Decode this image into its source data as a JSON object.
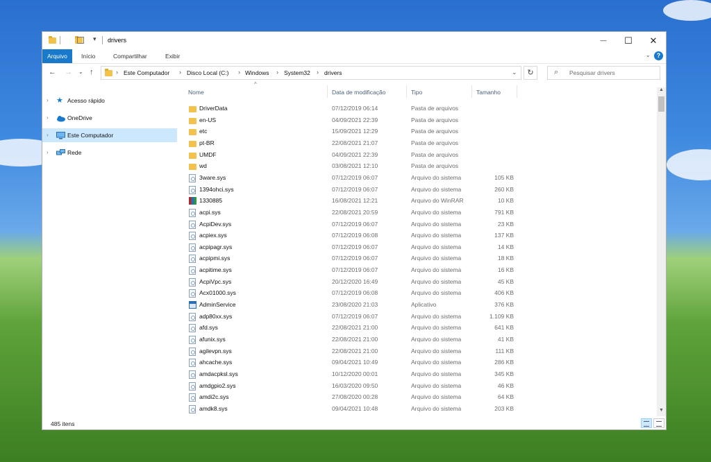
{
  "window": {
    "title": "drivers",
    "controls": {
      "minimize": "—",
      "maximize": "☐",
      "close": "✕"
    }
  },
  "ribbon": {
    "tabs": [
      {
        "label": "Arquivo"
      },
      {
        "label": "Início"
      },
      {
        "label": "Compartilhar"
      },
      {
        "label": "Exibir"
      }
    ],
    "help_label": "?",
    "expand_glyph": "⌄"
  },
  "nav": {
    "back": "←",
    "forward": "→",
    "recent": "⌄",
    "up": "↑",
    "breadcrumbs": [
      "Este Computador",
      "Disco Local (C:)",
      "Windows",
      "System32",
      "drivers"
    ],
    "breadcrumb_separator": "›",
    "dropdown": "⌄",
    "refresh": "↻",
    "search_placeholder": "Pesquisar drivers",
    "search_icon": "⌕"
  },
  "sidebar": {
    "items": [
      {
        "label": "Acesso rápido",
        "icon": "star-icon",
        "color": "#1979ca"
      },
      {
        "label": "OneDrive",
        "icon": "cloud-icon",
        "color": "#1979ca"
      },
      {
        "label": "Este Computador",
        "icon": "computer-icon",
        "color": "#2a8bd8",
        "selected": true
      },
      {
        "label": "Rede",
        "icon": "network-icon",
        "color": "#2a8bd8"
      }
    ],
    "arrow": "›"
  },
  "list": {
    "columns": {
      "name": "Nome",
      "date": "Data de modificação",
      "type": "Tipo",
      "size": "Tamanho"
    },
    "sort_indicator": "^",
    "rows": [
      {
        "name": "DriverData",
        "date": "07/12/2019 06:14",
        "type": "Pasta de arquivos",
        "size": "",
        "icon": "folder"
      },
      {
        "name": "en-US",
        "date": "04/09/2021 22:39",
        "type": "Pasta de arquivos",
        "size": "",
        "icon": "folder"
      },
      {
        "name": "etc",
        "date": "15/09/2021 12:29",
        "type": "Pasta de arquivos",
        "size": "",
        "icon": "folder"
      },
      {
        "name": "pt-BR",
        "date": "22/08/2021 21:07",
        "type": "Pasta de arquivos",
        "size": "",
        "icon": "folder"
      },
      {
        "name": "UMDF",
        "date": "04/09/2021 22:39",
        "type": "Pasta de arquivos",
        "size": "",
        "icon": "folder"
      },
      {
        "name": "wd",
        "date": "03/08/2021 12:10",
        "type": "Pasta de arquivos",
        "size": "",
        "icon": "folder"
      },
      {
        "name": "3ware.sys",
        "date": "07/12/2019 06:07",
        "type": "Arquivo do sistema",
        "size": "105 KB",
        "icon": "sys"
      },
      {
        "name": "1394ohci.sys",
        "date": "07/12/2019 06:07",
        "type": "Arquivo do sistema",
        "size": "260 KB",
        "icon": "sys"
      },
      {
        "name": "1330885",
        "date": "16/08/2021 12:21",
        "type": "Arquivo do WinRAR",
        "size": "10 KB",
        "icon": "rar"
      },
      {
        "name": "acpi.sys",
        "date": "22/08/2021 20:59",
        "type": "Arquivo do sistema",
        "size": "791 KB",
        "icon": "sys"
      },
      {
        "name": "AcpiDev.sys",
        "date": "07/12/2019 06:07",
        "type": "Arquivo do sistema",
        "size": "23 KB",
        "icon": "sys"
      },
      {
        "name": "acpiex.sys",
        "date": "07/12/2019 06:08",
        "type": "Arquivo do sistema",
        "size": "137 KB",
        "icon": "sys"
      },
      {
        "name": "acpipagr.sys",
        "date": "07/12/2019 06:07",
        "type": "Arquivo do sistema",
        "size": "14 KB",
        "icon": "sys"
      },
      {
        "name": "acpipmi.sys",
        "date": "07/12/2019 06:07",
        "type": "Arquivo do sistema",
        "size": "18 KB",
        "icon": "sys"
      },
      {
        "name": "acpitime.sys",
        "date": "07/12/2019 06:07",
        "type": "Arquivo do sistema",
        "size": "16 KB",
        "icon": "sys"
      },
      {
        "name": "AcpiVpc.sys",
        "date": "20/12/2020 16:49",
        "type": "Arquivo do sistema",
        "size": "45 KB",
        "icon": "sys"
      },
      {
        "name": "Acx01000.sys",
        "date": "07/12/2019 06:08",
        "type": "Arquivo do sistema",
        "size": "406 KB",
        "icon": "sys"
      },
      {
        "name": "AdminService",
        "date": "23/08/2020 21:03",
        "type": "Aplicativo",
        "size": "376 KB",
        "icon": "app"
      },
      {
        "name": "adp80xx.sys",
        "date": "07/12/2019 06:07",
        "type": "Arquivo do sistema",
        "size": "1.109 KB",
        "icon": "sys"
      },
      {
        "name": "afd.sys",
        "date": "22/08/2021 21:00",
        "type": "Arquivo do sistema",
        "size": "641 KB",
        "icon": "sys"
      },
      {
        "name": "afunix.sys",
        "date": "22/08/2021 21:00",
        "type": "Arquivo do sistema",
        "size": "41 KB",
        "icon": "sys"
      },
      {
        "name": "agilevpn.sys",
        "date": "22/08/2021 21:00",
        "type": "Arquivo do sistema",
        "size": "111 KB",
        "icon": "sys"
      },
      {
        "name": "ahcache.sys",
        "date": "09/04/2021 10:49",
        "type": "Arquivo do sistema",
        "size": "286 KB",
        "icon": "sys"
      },
      {
        "name": "amdacpksl.sys",
        "date": "10/12/2020 00:01",
        "type": "Arquivo do sistema",
        "size": "345 KB",
        "icon": "sys"
      },
      {
        "name": "amdgpio2.sys",
        "date": "16/03/2020 09:50",
        "type": "Arquivo do sistema",
        "size": "46 KB",
        "icon": "sys"
      },
      {
        "name": "amdi2c.sys",
        "date": "27/08/2020 00:28",
        "type": "Arquivo do sistema",
        "size": "64 KB",
        "icon": "sys"
      },
      {
        "name": "amdk8.sys",
        "date": "09/04/2021 10:48",
        "type": "Arquivo do sistema",
        "size": "203 KB",
        "icon": "sys"
      }
    ]
  },
  "status": {
    "item_count": "485 itens"
  },
  "scrollbar": {
    "up": "▲",
    "down": "▼"
  }
}
